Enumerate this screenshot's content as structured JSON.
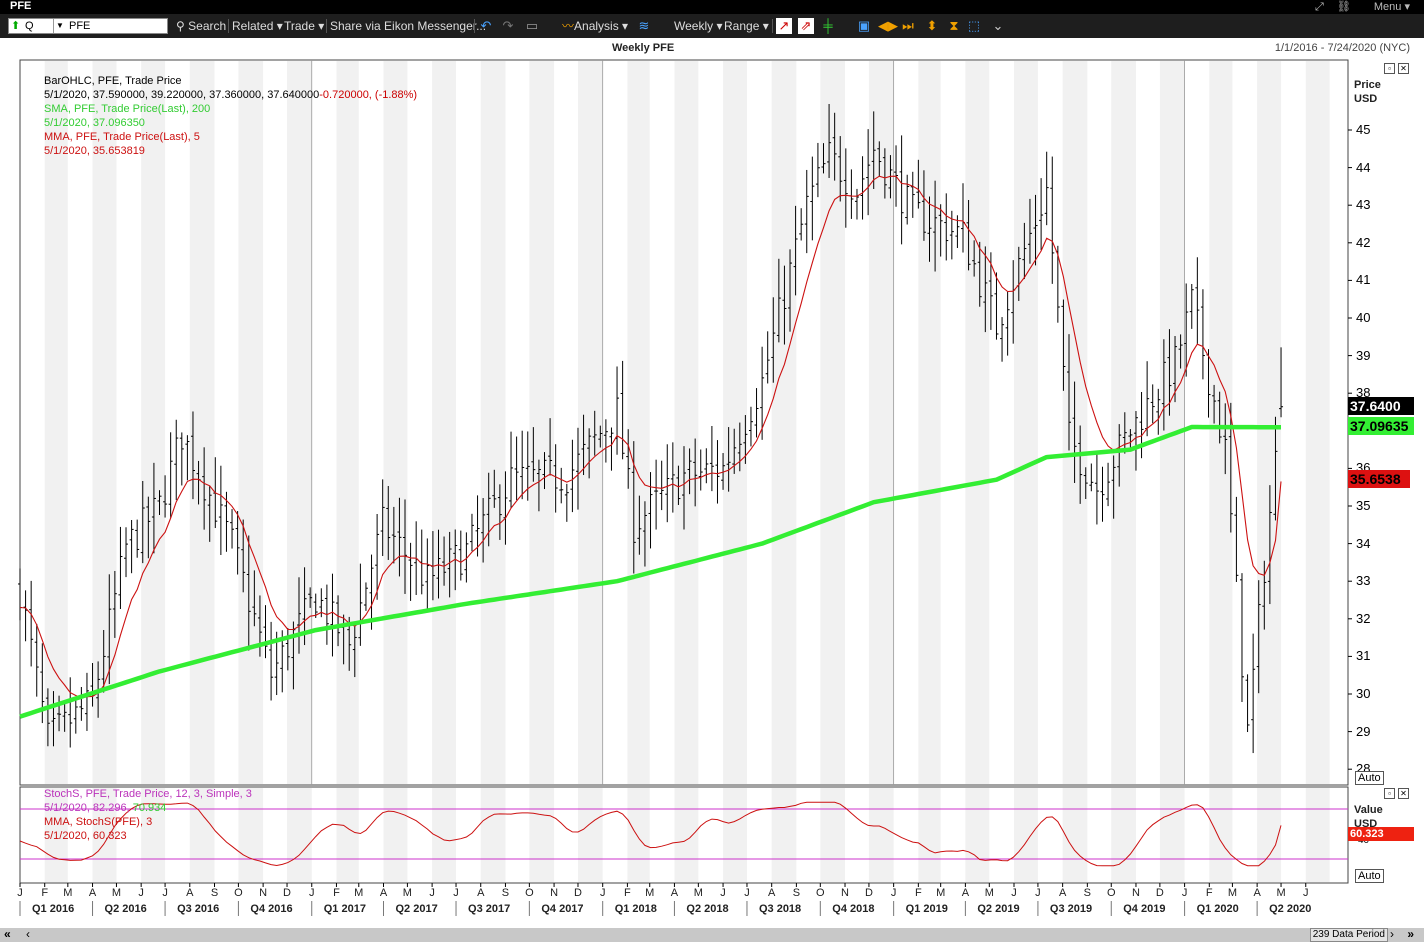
{
  "window": {
    "title": "PFE",
    "menu_label": "Menu"
  },
  "toolbar": {
    "ric_prefix": "Q",
    "ric_value": "PFE",
    "search": "Search",
    "related": "Related",
    "trade": "Trade",
    "share": "Share via Eikon Messenger...",
    "analysis": "Analysis",
    "interval": "Weekly",
    "range": "Range"
  },
  "header": {
    "title": "Weekly PFE",
    "date_range": "1/1/2016 - 7/24/2020 (NYC)"
  },
  "legend": {
    "ohlc_title": "BarOHLC, PFE, Trade Price",
    "ohlc_values": "5/1/2020, 37.590000, 39.220000, 37.360000, 37.640000",
    "ohlc_change": "-0.720000, (-1.88%)",
    "sma_title": "SMA, PFE, Trade Price(Last),  200",
    "sma_value": "5/1/2020, 37.096350",
    "mma_title": "MMA, PFE, Trade Price(Last),  5",
    "mma_value": "5/1/2020, 35.653819",
    "stoch_title": "StochS, PFE, Trade Price,  12, 3, Simple, 3",
    "stoch_date": "5/1/2020, 82.296,",
    "stoch_d": "70.934",
    "smma_title": "MMA, StochS(PFE),  3",
    "smma_value": "5/1/2020, 60.323"
  },
  "price_axis": {
    "title_line1": "Price",
    "title_line2": "USD",
    "ticks": [
      "45",
      "44",
      "43",
      "42",
      "41",
      "40",
      "39",
      "38",
      "37",
      "36",
      "35",
      "34",
      "33",
      "32",
      "31",
      "30",
      "29",
      "28"
    ],
    "last_tag": "37.6400",
    "sma_tag": "37.09635",
    "mma_tag": "35.6538",
    "auto": "Auto"
  },
  "stoch_axis": {
    "title_line1": "Value",
    "title_line2": "USD",
    "tick": "40",
    "mma_tag": "60.323",
    "auto": "Auto"
  },
  "x_axis": {
    "months": [
      "J",
      "F",
      "M",
      "A",
      "M",
      "J",
      "J",
      "A",
      "S",
      "O",
      "N",
      "D",
      "J",
      "F",
      "M",
      "A",
      "M",
      "J",
      "J",
      "A",
      "S",
      "O",
      "N",
      "D",
      "J",
      "F",
      "M",
      "A",
      "M",
      "J",
      "J",
      "A",
      "S",
      "O",
      "N",
      "D",
      "J",
      "F",
      "M",
      "A",
      "M",
      "J",
      "J",
      "A",
      "S",
      "O",
      "N",
      "D",
      "J",
      "F",
      "M",
      "A",
      "M",
      "J"
    ],
    "quarters": [
      "Q1 2016",
      "Q2 2016",
      "Q3 2016",
      "Q4 2016",
      "Q1 2017",
      "Q2 2017",
      "Q3 2017",
      "Q4 2017",
      "Q1 2018",
      "Q2 2018",
      "Q3 2018",
      "Q4 2018",
      "Q1 2019",
      "Q2 2019",
      "Q3 2019",
      "Q4 2019",
      "Q1 2020",
      "Q2 2020"
    ]
  },
  "status": {
    "data_period": "239 Data Period"
  },
  "colors": {
    "sma": "#33ee33",
    "mma": "#cc1111",
    "stoch_title": "#bb33bb",
    "bands": "#cc33cc",
    "last_tag_bg": "#000000"
  },
  "chart_data": {
    "type": "ohlc_bar",
    "title": "Weekly PFE",
    "interval": "weekly",
    "x_start": "2016-01-01",
    "x_end": "2020-07-24",
    "y_unit": "USD",
    "y_range": [
      27.5,
      46.5
    ],
    "key_points": [
      {
        "date": "2016-01-01",
        "price": 32.8
      },
      {
        "date": "2016-02-05",
        "price": 28.8
      },
      {
        "date": "2016-04-01",
        "price": 29.8
      },
      {
        "date": "2016-05-13",
        "price": 33.9
      },
      {
        "date": "2016-06-24",
        "price": 35.0
      },
      {
        "date": "2016-07-22",
        "price": 36.9
      },
      {
        "date": "2016-09-23",
        "price": 34.0
      },
      {
        "date": "2016-11-11",
        "price": 30.5
      },
      {
        "date": "2017-01-06",
        "price": 32.6
      },
      {
        "date": "2017-02-17",
        "price": 31.3
      },
      {
        "date": "2017-03-31",
        "price": 34.5
      },
      {
        "date": "2017-05-26",
        "price": 33.0
      },
      {
        "date": "2017-07-14",
        "price": 33.8
      },
      {
        "date": "2017-09-08",
        "price": 35.7
      },
      {
        "date": "2017-11-17",
        "price": 35.8
      },
      {
        "date": "2018-01-19",
        "price": 37.5
      },
      {
        "date": "2018-02-09",
        "price": 34.5
      },
      {
        "date": "2018-04-13",
        "price": 35.8
      },
      {
        "date": "2018-06-01",
        "price": 36.0
      },
      {
        "date": "2018-07-20",
        "price": 38.3
      },
      {
        "date": "2018-09-14",
        "price": 43.0
      },
      {
        "date": "2018-10-12",
        "price": 44.3
      },
      {
        "date": "2018-11-16",
        "price": 43.4
      },
      {
        "date": "2018-12-07",
        "price": 44.5
      },
      {
        "date": "2019-01-25",
        "price": 42.8
      },
      {
        "date": "2019-03-29",
        "price": 42.2
      },
      {
        "date": "2019-05-10",
        "price": 39.8
      },
      {
        "date": "2019-07-12",
        "price": 43.4
      },
      {
        "date": "2019-08-09",
        "price": 36.8
      },
      {
        "date": "2019-09-13",
        "price": 35.5
      },
      {
        "date": "2019-10-25",
        "price": 37.0
      },
      {
        "date": "2019-12-20",
        "price": 38.8
      },
      {
        "date": "2020-01-10",
        "price": 40.4
      },
      {
        "date": "2020-02-21",
        "price": 36.5
      },
      {
        "date": "2020-03-20",
        "price": 29.0
      },
      {
        "date": "2020-04-10",
        "price": 33.4
      },
      {
        "date": "2020-05-01",
        "price": 37.64
      }
    ],
    "sma_200": [
      {
        "date": "2016-01-01",
        "value": 29.4
      },
      {
        "date": "2016-06-24",
        "value": 30.6
      },
      {
        "date": "2017-01-06",
        "value": 31.7
      },
      {
        "date": "2017-07-14",
        "value": 32.4
      },
      {
        "date": "2018-01-19",
        "value": 33.0
      },
      {
        "date": "2018-07-20",
        "value": 34.0
      },
      {
        "date": "2018-12-07",
        "value": 35.1
      },
      {
        "date": "2019-05-10",
        "value": 35.7
      },
      {
        "date": "2019-07-12",
        "value": 36.3
      },
      {
        "date": "2019-10-25",
        "value": 36.5
      },
      {
        "date": "2020-01-10",
        "value": 37.1
      },
      {
        "date": "2020-05-01",
        "value": 37.096
      }
    ],
    "last_bar": {
      "date": "2020-05-01",
      "open": 37.59,
      "high": 39.22,
      "low": 37.36,
      "close": 37.64,
      "change": -0.72,
      "change_pct": -1.88
    },
    "sma_last": 37.09635,
    "mma_last": 35.653819,
    "stochastic": {
      "params": [
        12,
        3,
        "Simple",
        3
      ],
      "last": {
        "k": 82.296,
        "d": 70.934,
        "mma": 60.323
      }
    }
  }
}
